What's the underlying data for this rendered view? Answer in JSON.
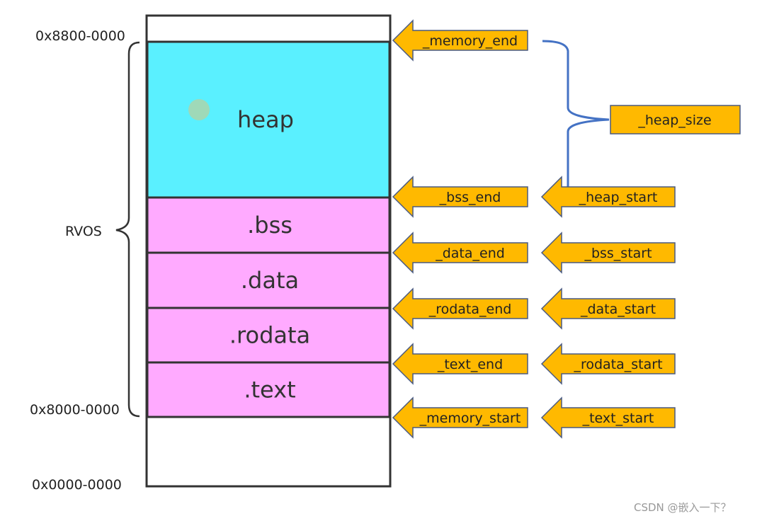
{
  "addresses": {
    "top": "0x8800-0000",
    "rvos_start": "0x8000-0000",
    "bottom": "0x0000-0000"
  },
  "brace_label": "RVOS",
  "segments": [
    {
      "name": "heap",
      "color": "#5af0ff"
    },
    {
      "name": ".bss",
      "color": "#ffaaff"
    },
    {
      "name": ".data",
      "color": "#ffaaff"
    },
    {
      "name": ".rodata",
      "color": "#ffaaff"
    },
    {
      "name": ".text",
      "color": "#ffaaff"
    }
  ],
  "left_arrows": [
    "_memory_end",
    "_bss_end",
    "_data_end",
    "_rodata_end",
    "_text_end",
    "_memory_start"
  ],
  "right_arrows": [
    "_heap_start",
    "_bss_start",
    "_data_start",
    "_rodata_start",
    "_text_start"
  ],
  "heap_size_label": "_heap_size",
  "colors": {
    "arrow_fill": "#ffb900",
    "brace_blue": "#4472c4",
    "heap": "#5af0ff",
    "section": "#ffaaff"
  },
  "watermark": "CSDN @嵌入一下？"
}
